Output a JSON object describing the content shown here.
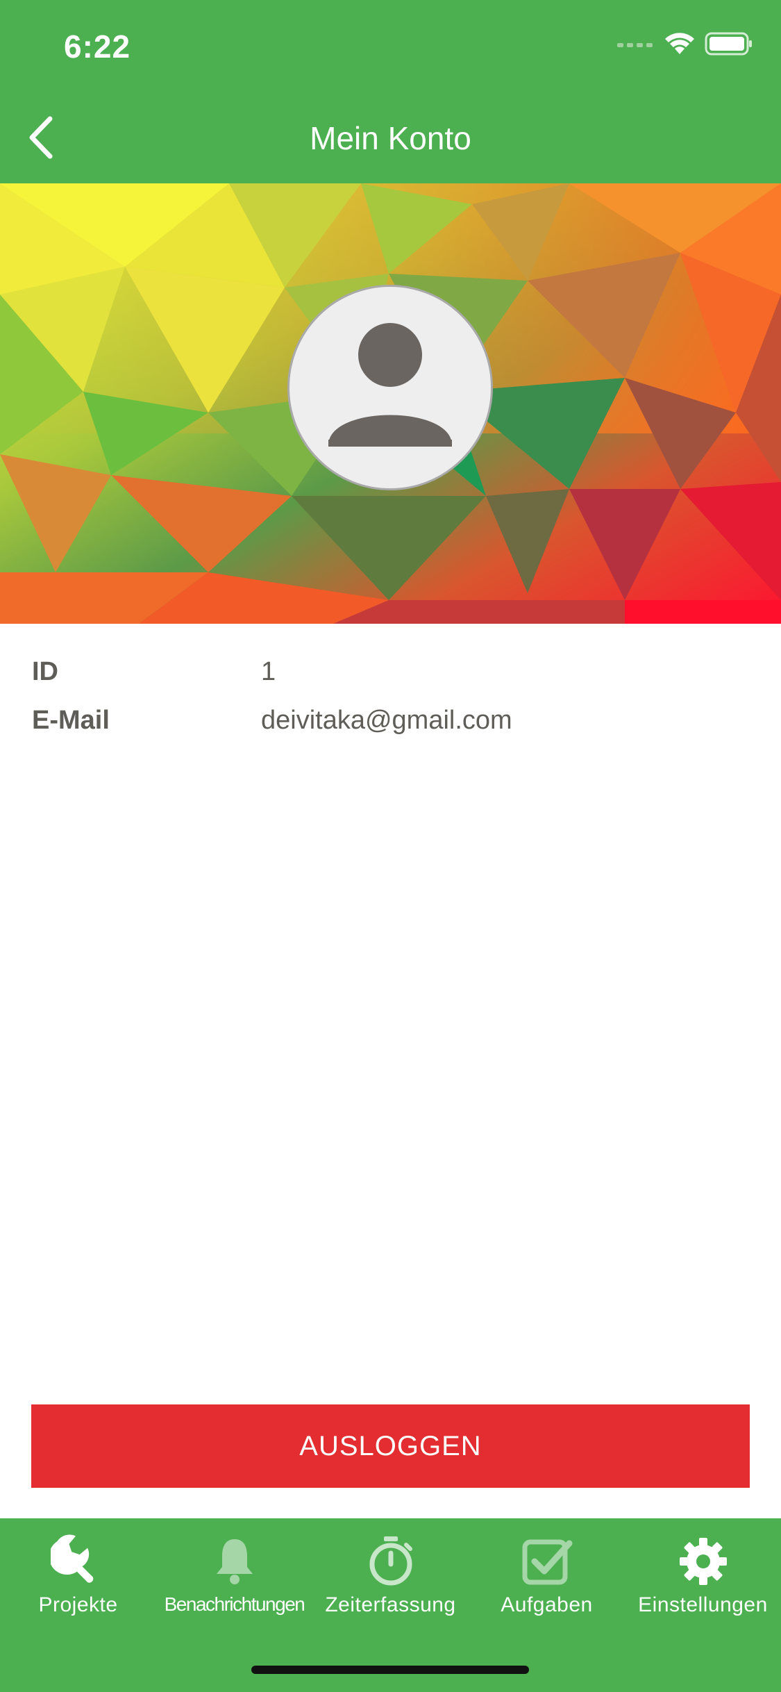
{
  "status_bar": {
    "time": "6:22"
  },
  "header": {
    "title": "Mein Konto"
  },
  "profile": {
    "rows": [
      {
        "label": "ID",
        "value": "1"
      },
      {
        "label": "E-Mail",
        "value": "deivitaka@gmail.com"
      }
    ]
  },
  "actions": {
    "logout_label": "AUSLOGGEN"
  },
  "tabbar": {
    "items": [
      {
        "label": "Projekte",
        "icon": "wrench-icon",
        "active": true
      },
      {
        "label": "Benachrichtungen",
        "icon": "bell-icon",
        "active": false
      },
      {
        "label": "Zeiterfassung",
        "icon": "stopwatch-icon",
        "active": true
      },
      {
        "label": "Aufgaben",
        "icon": "checkbox-icon",
        "active": false
      },
      {
        "label": "Einstellungen",
        "icon": "gear-icon",
        "active": true
      }
    ]
  },
  "colors": {
    "primary": "#4caf50",
    "logout": "#e32d30",
    "text": "#5f5d57",
    "inactive_icon": "#a5d6a7"
  }
}
